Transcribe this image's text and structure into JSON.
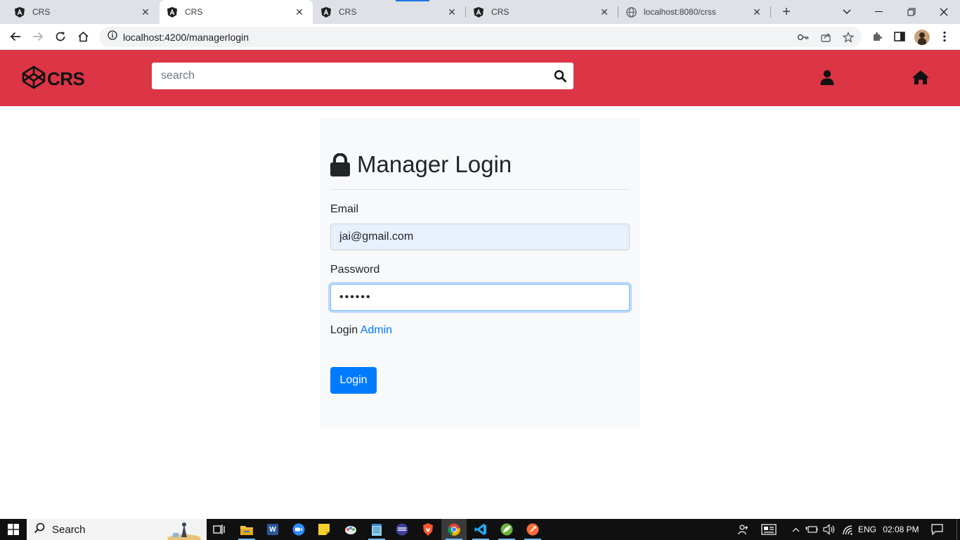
{
  "browser": {
    "tabs": [
      {
        "title": "CRS",
        "favicon": "angular-icon",
        "active": false
      },
      {
        "title": "CRS",
        "favicon": "angular-icon",
        "active": true
      },
      {
        "title": "CRS",
        "favicon": "angular-icon",
        "active": false
      },
      {
        "title": "CRS",
        "favicon": "angular-icon",
        "active": false
      },
      {
        "title": "localhost:8080/crss",
        "favicon": "globe-icon",
        "active": false
      }
    ],
    "url": "localhost:4200/managerlogin"
  },
  "header": {
    "brand": "CRS",
    "search_placeholder": "search",
    "brand_color": "#dc3545"
  },
  "login": {
    "title": "Manager Login",
    "email_label": "Email",
    "email_value": "jai@gmail.com",
    "password_label": "Password",
    "password_value": "••••••",
    "link_prefix": "Login",
    "link_text": "Admin",
    "button_label": "Login",
    "accent": "#007bff"
  },
  "taskbar": {
    "search_label": "Search",
    "language": "ENG",
    "time": "02:08 PM"
  }
}
